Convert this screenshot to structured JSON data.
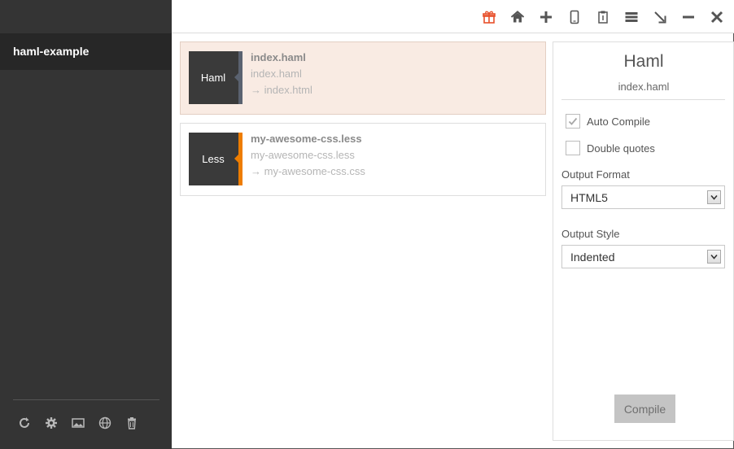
{
  "sidebar": {
    "project_name": "haml-example",
    "tools": [
      {
        "icon": "refresh-icon"
      },
      {
        "icon": "gear-icon"
      },
      {
        "icon": "image-icon"
      },
      {
        "icon": "globe-icon"
      },
      {
        "icon": "trash-icon"
      }
    ]
  },
  "toolbar": {
    "icons": [
      "gift-icon",
      "home-icon",
      "plus-icon",
      "mobile-icon",
      "clipboard-icon",
      "menu-icon",
      "minimize-to-corner-icon",
      "minimize-icon",
      "close-icon"
    ]
  },
  "files": [
    {
      "badge": "Haml",
      "name": "index.haml",
      "source": "index.haml",
      "output": "→ index.html",
      "stripe_color": "#5a6270",
      "selected": true
    },
    {
      "badge": "Less",
      "name": "my-awesome-css.less",
      "source": "my-awesome-css.less",
      "output": "→ my-awesome-css.css",
      "stripe_color": "#ee7d00",
      "selected": false
    }
  ],
  "panel": {
    "title": "Haml",
    "subtitle": "index.haml",
    "auto_compile_label": "Auto Compile",
    "auto_compile_checked": true,
    "double_quotes_label": "Double quotes",
    "double_quotes_checked": false,
    "output_format_label": "Output Format",
    "output_format_value": "HTML5",
    "output_style_label": "Output Style",
    "output_style_value": "Indented",
    "compile_label": "Compile"
  },
  "colors": {
    "accent": "#e8502b",
    "sidebar_bg": "#343434",
    "selected_card_bg": "#f9ebe3"
  }
}
